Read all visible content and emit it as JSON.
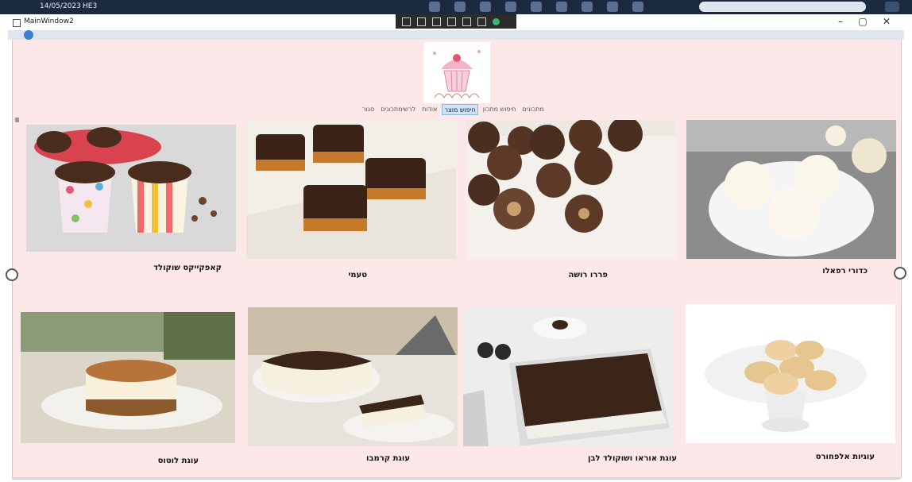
{
  "taskbar": {
    "date": "14/05/2023",
    "time_label": "HE3"
  },
  "window": {
    "title": "MainWindow2",
    "minimize": "–",
    "maximize": "▢",
    "close": "✕"
  },
  "nav": {
    "items": [
      "מתכונים",
      "חיפוש מתכון",
      "חיפוש מוצר",
      "אודות",
      "לרשימתכונים",
      "סגור"
    ],
    "active_index": 2
  },
  "recipes": [
    {
      "title": "כדורי רפאלו",
      "image": "raffaello-balls"
    },
    {
      "title": "פררו רושה",
      "image": "ferrero-rocher"
    },
    {
      "title": "טעמי",
      "image": "taami-bars"
    },
    {
      "title": "קאפקייקס שוקולד",
      "image": "chocolate-cupcakes"
    },
    {
      "title": "עוגיות אלפחורס",
      "image": "alfajores-cookies"
    },
    {
      "title": "עוגת אוראו ושוקולד לבן",
      "image": "oreo-white-chocolate-cake"
    },
    {
      "title": "עוגת קרמבו",
      "image": "krembo-cake"
    },
    {
      "title": "עוגת לוטוס",
      "image": "lotus-cake"
    }
  ],
  "colors": {
    "content_bg": "#fde8e9",
    "active_nav": "#cfe3f6",
    "taskbar": "#1c2a3f"
  }
}
